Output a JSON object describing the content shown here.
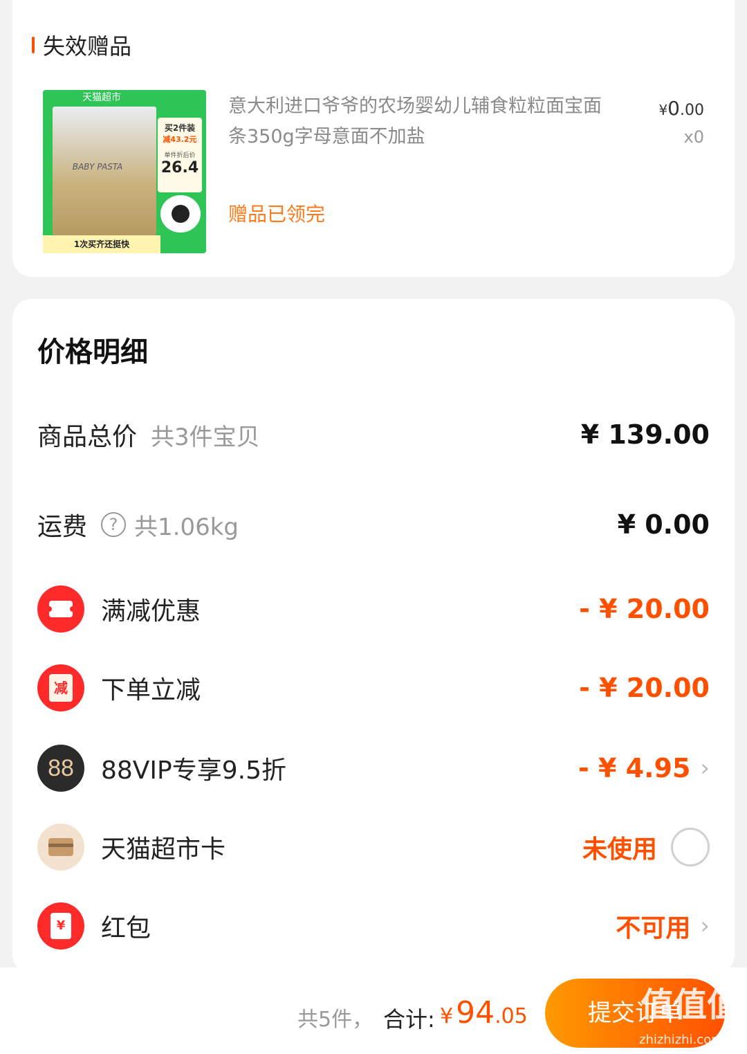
{
  "gift_section": {
    "title": "失效赠品",
    "product": {
      "image": {
        "brand": "天猫超市",
        "promo_line1": "买2件装",
        "promo_line2": "减43.2元",
        "unit_price_label": "单件折后价",
        "unit_price": "26.4",
        "box_label": "BABY PASTA",
        "bottom_text": "1次买齐还挺快"
      },
      "name": "意大利进口爷爷的农场婴幼儿辅食粒粒面宝面条350g字母意面不加盐",
      "price_yen": "¥",
      "price_int": "0",
      "price_dec": ".00",
      "qty": "x0",
      "status": "赠品已领完"
    }
  },
  "price_detail": {
    "title": "价格明细",
    "rows": [
      {
        "label": "商品总价",
        "sub": "共3件宝贝",
        "value": "¥ 139.00"
      },
      {
        "label": "运费",
        "help": "?",
        "sub": "共1.06kg",
        "value": "¥ 0.00"
      },
      {
        "icon": "ticket-icon",
        "label": "满减优惠",
        "value": "- ¥ 20.00"
      },
      {
        "icon": "jian-icon",
        "icon_text": "减",
        "label": "下单立减",
        "value": "- ¥ 20.00"
      },
      {
        "icon": "vip88-icon",
        "icon_text": "88",
        "label": "88VIP专享9.5折",
        "value": "- ¥ 4.95"
      },
      {
        "icon": "card-icon",
        "label": "天猫超市卡",
        "value": "未使用"
      },
      {
        "icon": "red-packet-icon",
        "icon_text": "¥",
        "label": "红包",
        "value": "不可用"
      }
    ]
  },
  "bottom_bar": {
    "count": "共5件，",
    "total_label": "合计:",
    "total_yen": "¥",
    "total_int": "94",
    "total_dec": ".05",
    "submit": "提交订单"
  },
  "watermark": {
    "big": "值值值",
    "url": "zhizhizhi.com"
  },
  "colors": {
    "accent": "#ff5000",
    "gift_status": "#ff7a1a",
    "icon_red": "#ff2a2a"
  }
}
